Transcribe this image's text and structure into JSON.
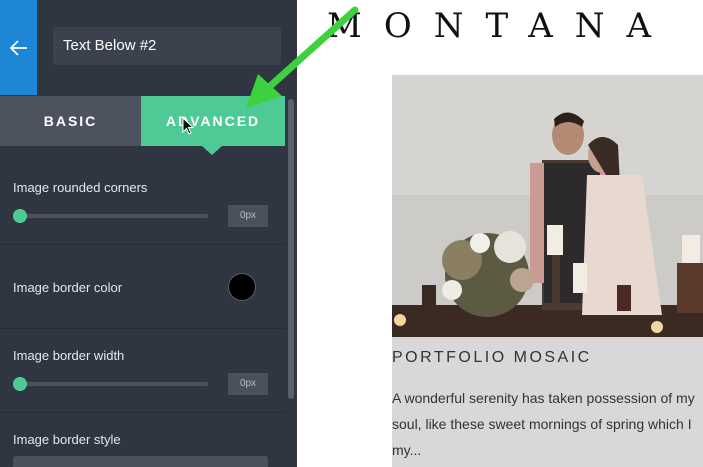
{
  "header": {
    "back_icon": "arrow-left-icon",
    "title_value": "Text Below #2"
  },
  "tabs": [
    {
      "label": "BASIC",
      "active": false
    },
    {
      "label": "ADVANCED",
      "active": true
    }
  ],
  "settings": {
    "rounded_corners": {
      "label": "Image rounded corners",
      "value": "0px"
    },
    "border_color": {
      "label": "Image border color",
      "color": "#000000"
    },
    "border_width": {
      "label": "Image border width",
      "value": "0px"
    },
    "border_style": {
      "label": "Image border style"
    }
  },
  "preview": {
    "logo": "MONTANA",
    "card_title": "PORTFOLIO MOSAIC",
    "card_text": "A wonderful serenity has taken possession of my\nsoul, like these sweet mornings of spring which I\nmy..."
  },
  "colors": {
    "panel_bg": "#2f3541",
    "accent_green": "#4ecb95",
    "back_blue": "#1d86d6",
    "annotation_arrow": "#3ed13e"
  }
}
